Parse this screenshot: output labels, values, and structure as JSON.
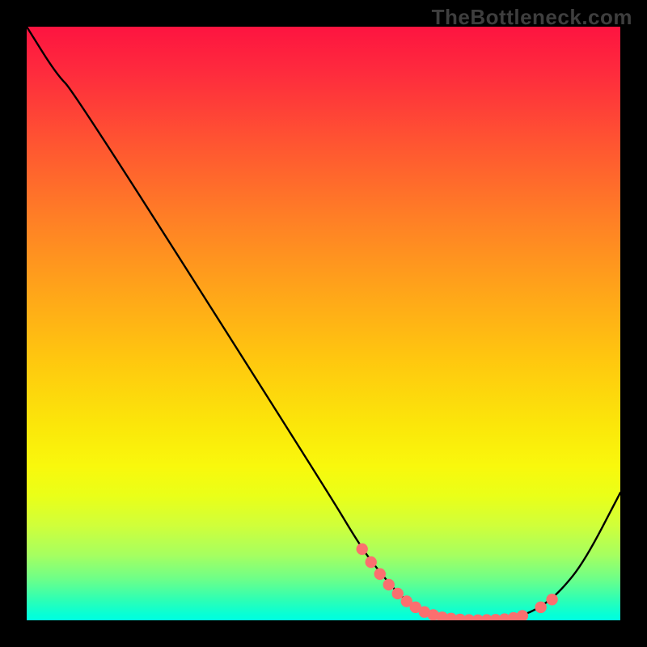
{
  "watermark": "TheBottleneck.com",
  "chart_data": {
    "type": "line",
    "title": "",
    "xlabel": "",
    "ylabel": "",
    "xlim": [
      0,
      100
    ],
    "ylim": [
      0,
      100
    ],
    "series": [
      {
        "name": "curve",
        "points": [
          [
            0,
            100
          ],
          [
            5,
            92
          ],
          [
            8,
            89
          ],
          [
            50.5,
            22
          ],
          [
            56.5,
            12
          ],
          [
            60,
            7.5
          ],
          [
            63,
            4
          ],
          [
            67,
            1.3
          ],
          [
            71,
            0.2
          ],
          [
            75,
            0
          ],
          [
            79,
            0.1
          ],
          [
            83,
            0.6
          ],
          [
            86.6,
            2.2
          ],
          [
            90,
            5
          ],
          [
            94,
            10
          ],
          [
            100,
            21.5
          ]
        ]
      }
    ],
    "markers": {
      "name": "highlight-dots",
      "color": "#fb6f6f",
      "points": [
        [
          56.5,
          12
        ],
        [
          58,
          9.8
        ],
        [
          59.5,
          7.8
        ],
        [
          61,
          6.0
        ],
        [
          62.5,
          4.5
        ],
        [
          64,
          3.2
        ],
        [
          65.5,
          2.2
        ],
        [
          67,
          1.4
        ],
        [
          68.5,
          0.9
        ],
        [
          70,
          0.5
        ],
        [
          71.5,
          0.3
        ],
        [
          73,
          0.15
        ],
        [
          74.5,
          0.05
        ],
        [
          76,
          0.03
        ],
        [
          77.5,
          0.05
        ],
        [
          79,
          0.1
        ],
        [
          80.5,
          0.2
        ],
        [
          82,
          0.4
        ],
        [
          83.5,
          0.75
        ],
        [
          86.6,
          2.2
        ],
        [
          88.5,
          3.5
        ]
      ]
    }
  }
}
